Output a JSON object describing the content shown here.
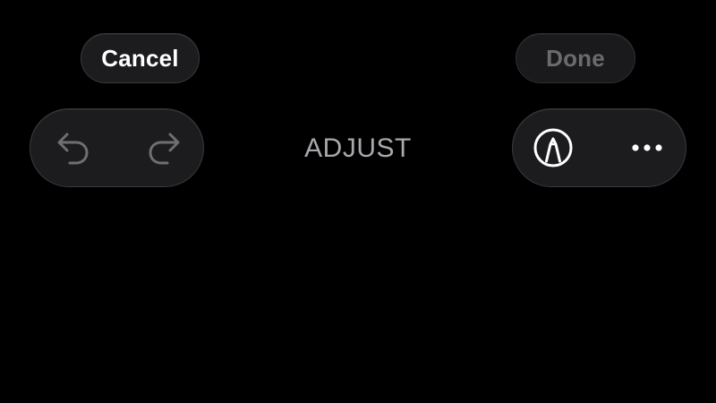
{
  "header": {
    "cancel_label": "Cancel",
    "done_label": "Done",
    "mode_title": "ADJUST"
  },
  "toolbar": {
    "left_group": [
      "undo-icon",
      "redo-icon"
    ],
    "right_group": [
      "markup-icon",
      "more-icon"
    ]
  },
  "colors": {
    "background": "#000000",
    "pill_fill": "#1c1c1e",
    "pill_border": "#3a3a3c",
    "active_text": "#ffffff",
    "disabled_text": "#6b6b6e",
    "title_text": "#a8a8ad",
    "disabled_icon": "#6e6e73"
  }
}
